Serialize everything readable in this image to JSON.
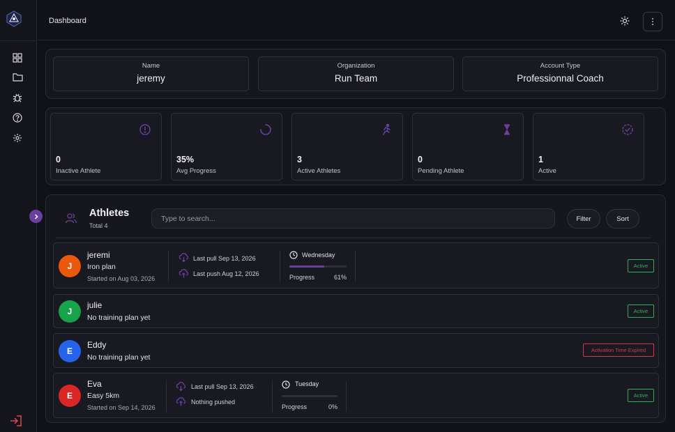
{
  "header": {
    "title": "Dashboard"
  },
  "profile": {
    "name_label": "Name",
    "name_value": "jeremy",
    "org_label": "Organization",
    "org_value": "Run Team",
    "type_label": "Account Type",
    "type_value": "Professionnal Coach"
  },
  "stats": [
    {
      "value": "0",
      "label": "Inactive Athlete",
      "icon": "alert-circle-icon"
    },
    {
      "value": "35%",
      "label": "Avg Progress",
      "icon": "loader-icon"
    },
    {
      "value": "3",
      "label": "Active Athletes",
      "icon": "running-icon"
    },
    {
      "value": "0",
      "label": "Pending Athlete",
      "icon": "hourglass-icon"
    },
    {
      "value": "1",
      "label": "Active",
      "icon": "check-circle-icon"
    }
  ],
  "athletes": {
    "title": "Athletes",
    "total": "Total 4",
    "search_placeholder": "Type to search...",
    "filter_label": "Filter",
    "sort_label": "Sort",
    "rows": [
      {
        "initial": "J",
        "color": "#ea580c",
        "name": "jeremi",
        "plan": "Iron plan",
        "started": "Started on Aug 03, 2026",
        "last_pull": "Last pull Sep 13, 2026",
        "last_push": "Last push Aug 12, 2026",
        "day": "Wednesday",
        "progress_label": "Progress",
        "progress_text": "61%",
        "progress": 0.61,
        "status": "Active"
      },
      {
        "initial": "J",
        "color": "#16a34a",
        "name": "julie",
        "plan": "No training plan yet",
        "status": "Active"
      },
      {
        "initial": "E",
        "color": "#2563eb",
        "name": "Eddy",
        "plan": "No training plan yet",
        "status": "Activation Time Expired"
      },
      {
        "initial": "E",
        "color": "#dc2626",
        "name": "Eva",
        "plan": "Easy 5km",
        "started": "Started on Sep 14, 2026",
        "last_pull": "Last pull Sep 13, 2026",
        "last_push": "Nothing pushed",
        "day": "Tuesday",
        "progress_label": "Progress",
        "progress_text": "0%",
        "progress": 0,
        "status": "Active"
      }
    ]
  },
  "colors": {
    "accent": "#6b3fa0",
    "active": "#2fae5a",
    "expired": "#d63b45"
  }
}
